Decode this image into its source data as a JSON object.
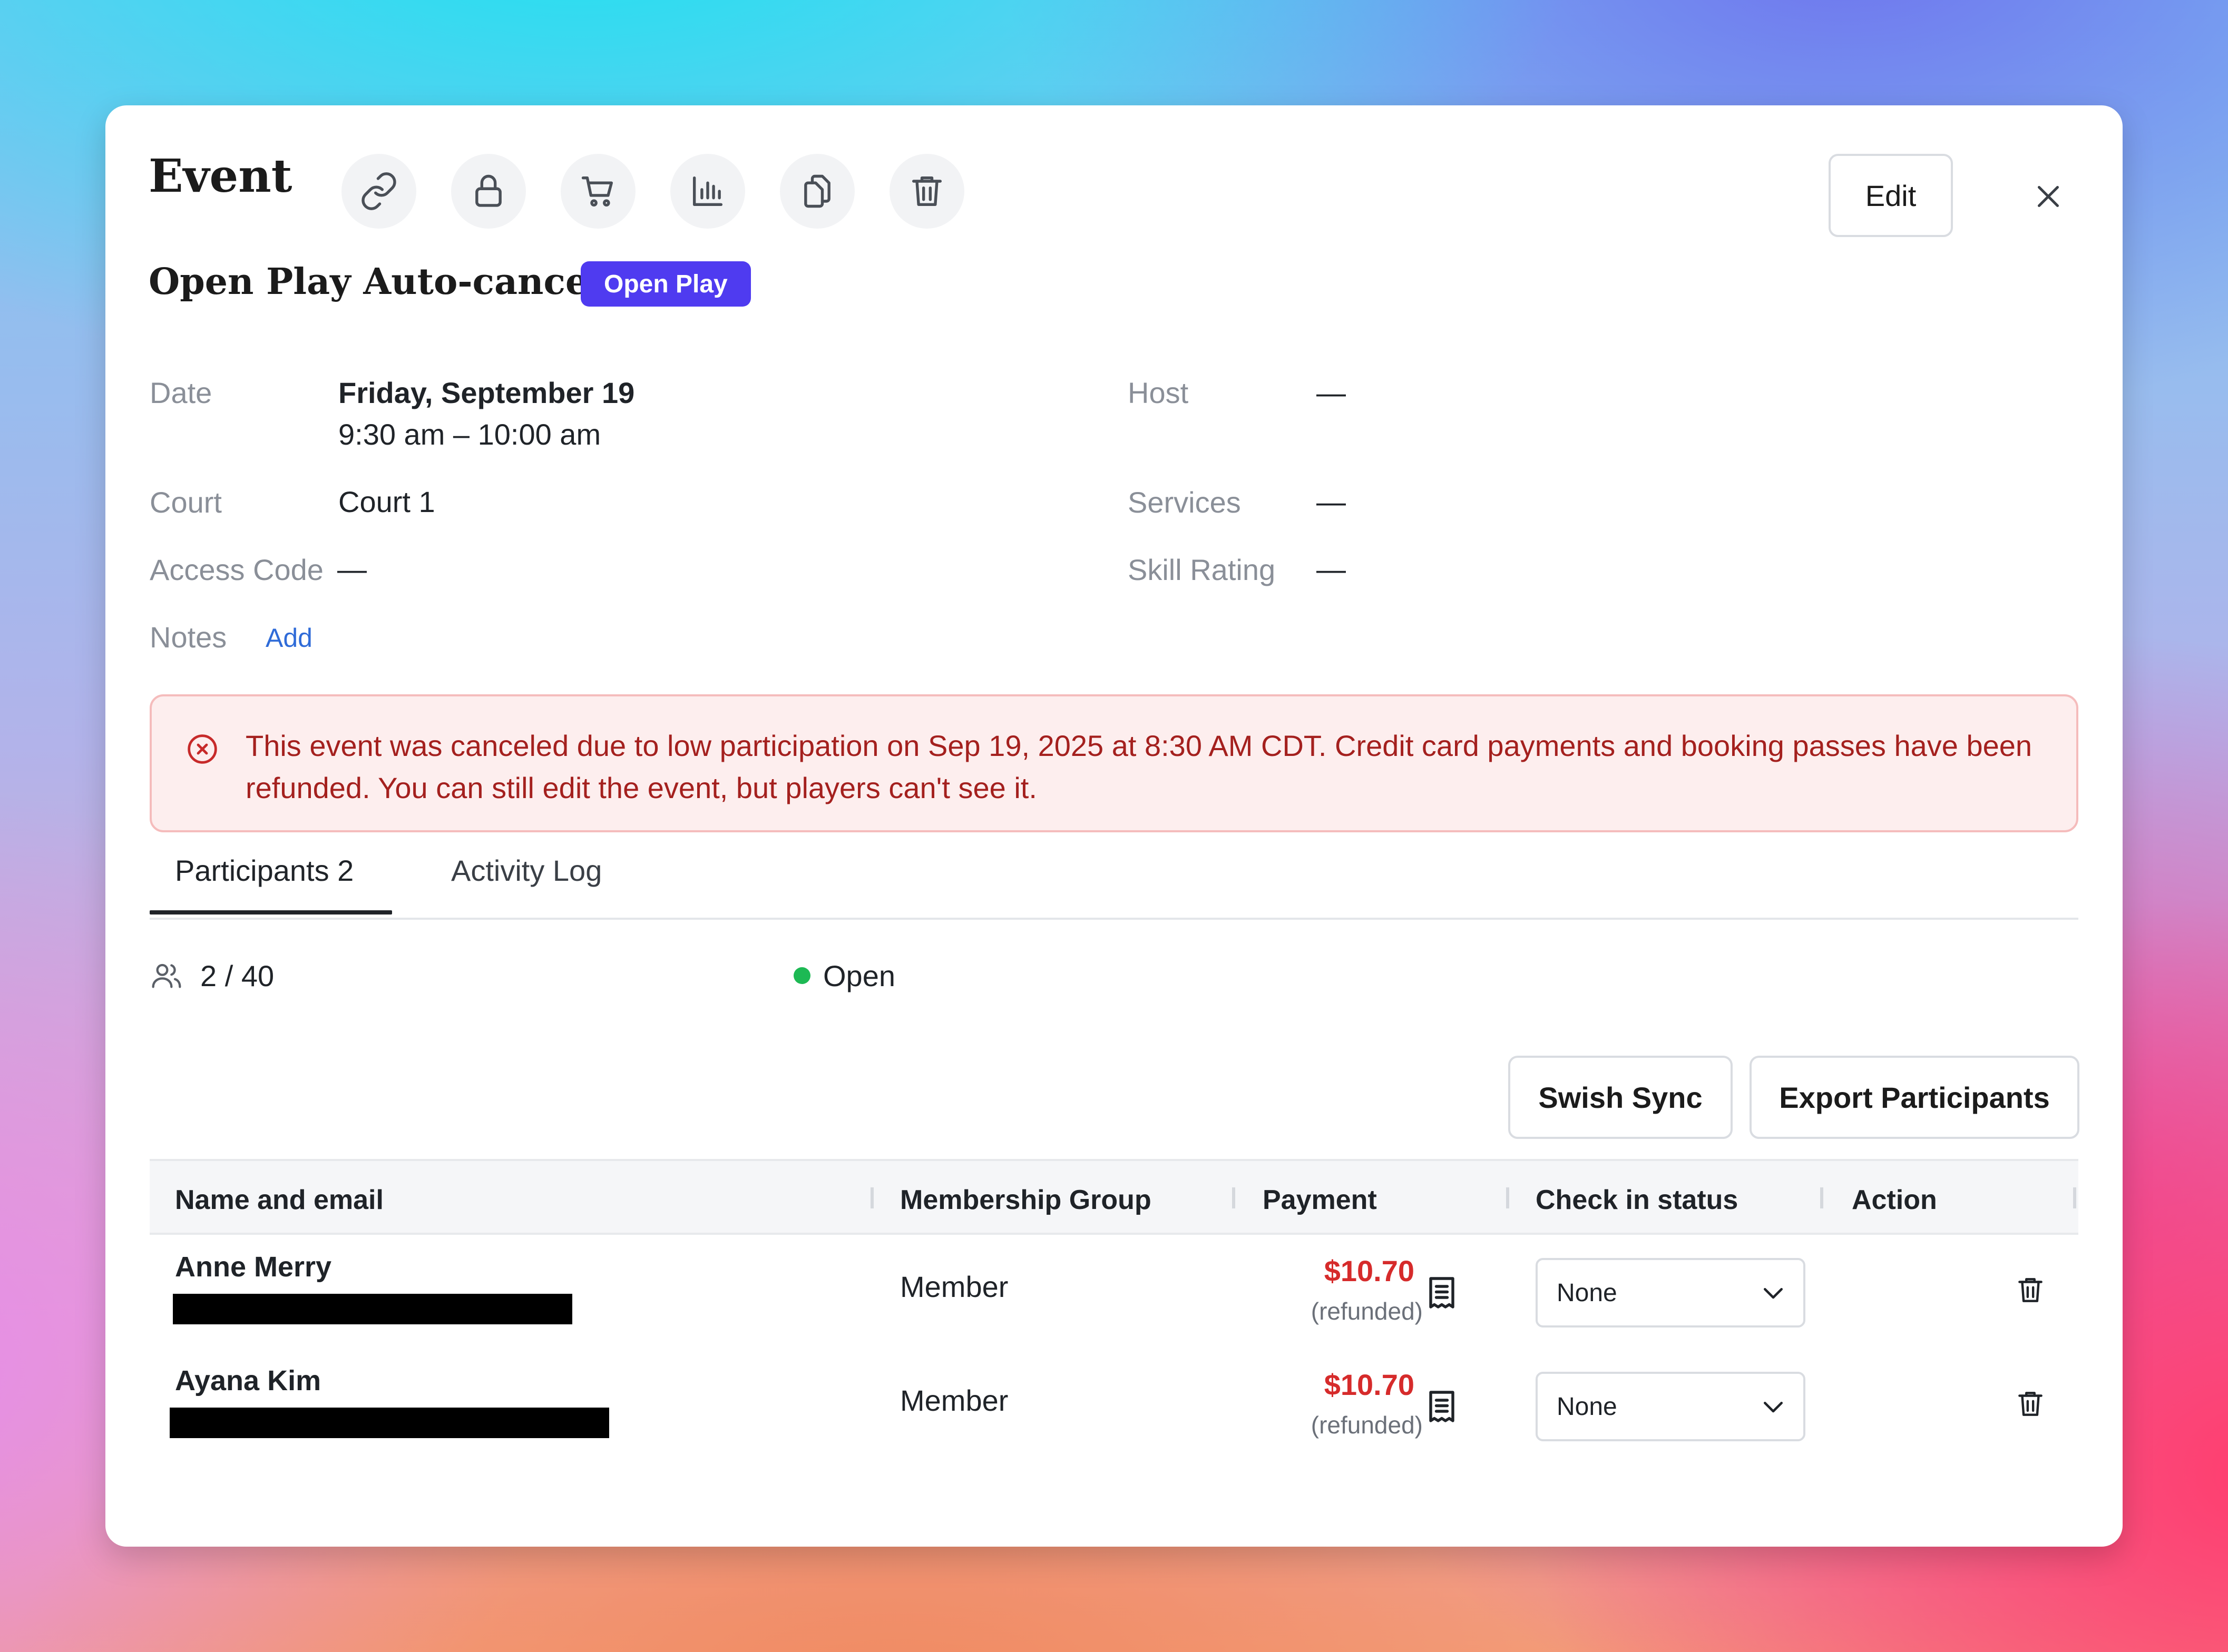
{
  "header": {
    "title": "Event",
    "edit_label": "Edit",
    "icons": [
      "link-icon",
      "lock-icon",
      "cart-icon",
      "chart-icon",
      "copy-icon",
      "trash-icon"
    ]
  },
  "event": {
    "name": "Open Play Auto-cancel",
    "badge": "Open Play",
    "date_label": "Date",
    "date_value": "Friday, September 19",
    "time_value": "9:30 am – 10:00 am",
    "court_label": "Court",
    "court_value": "Court 1",
    "access_label": "Access Code",
    "access_value": "—",
    "notes_label": "Notes",
    "notes_add": "Add",
    "host_label": "Host",
    "host_value": "—",
    "services_label": "Services",
    "services_value": "—",
    "skill_label": "Skill Rating",
    "skill_value": "—"
  },
  "alert": {
    "text": "This event was canceled due to low participation on Sep 19, 2025 at 8:30 AM CDT. Credit card payments and booking passes have been refunded. You can still edit the event, but players can't see it."
  },
  "tabs": [
    {
      "label": "Participants 2",
      "active": true
    },
    {
      "label": "Activity Log",
      "active": false
    }
  ],
  "summary": {
    "count": "2 / 40",
    "status": "Open",
    "status_color": "#1db954"
  },
  "actions": {
    "sync_label": "Swish Sync",
    "export_label": "Export Participants"
  },
  "table": {
    "headers": [
      "Name and email",
      "Membership Group",
      "Payment",
      "Check in status",
      "Action"
    ],
    "rows": [
      {
        "name": "Anne Merry",
        "group": "Member",
        "price": "$10.70",
        "price_note": "(refunded)",
        "checkin": "None"
      },
      {
        "name": "Ayana Kim",
        "group": "Member",
        "price": "$10.70",
        "price_note": "(refunded)",
        "checkin": "None"
      }
    ]
  },
  "colors": {
    "accent": "#4f3bf0",
    "danger": "#d62b2b",
    "link": "#2f6bd8"
  }
}
